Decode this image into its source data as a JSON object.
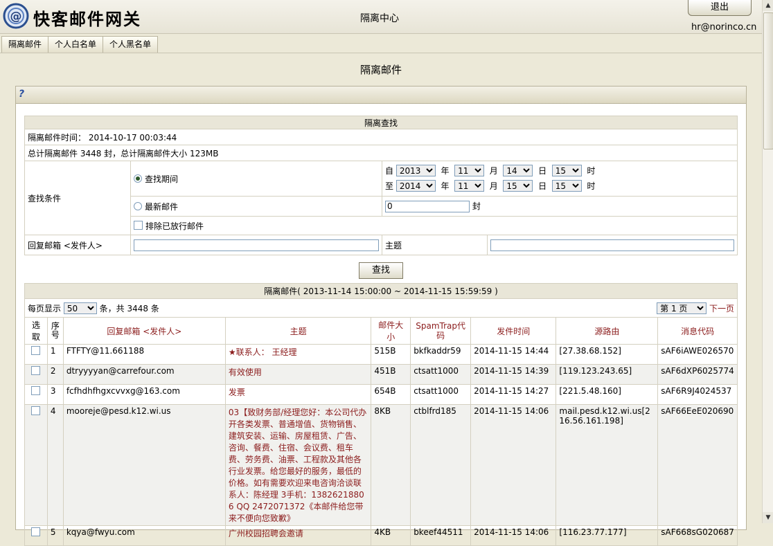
{
  "header": {
    "brand": "快客邮件网关",
    "center_title": "隔离中心",
    "logout_label": "退出",
    "user": "hr@norinco.cn"
  },
  "tabs": [
    "隔离邮件",
    "个人白名单",
    "个人黑名单"
  ],
  "main_title": "隔离邮件",
  "help_label": "?",
  "search": {
    "section_title": "隔离查找",
    "quarantine_time_label": "隔离邮件时间：",
    "quarantine_time_value": "2014-10-17 00:03:44",
    "summary": "总计隔离邮件 3448 封，总计隔离邮件大小 123MB",
    "criteria_label": "查找条件",
    "period_label": "查找期间",
    "from_label": "自",
    "to_label": "至",
    "year_unit": "年",
    "month_unit": "月",
    "day_unit": "日",
    "hour_unit": "时",
    "from": {
      "year": "2013",
      "month": "11",
      "day": "14",
      "hour": "15"
    },
    "to": {
      "year": "2014",
      "month": "11",
      "day": "15",
      "hour": "15"
    },
    "latest_label": "最新邮件",
    "latest_value": "0",
    "latest_unit": "封",
    "exclude_label": "排除已放行邮件",
    "sender_label": "回复邮箱 <发件人>",
    "sender_value": "",
    "subject_label": "主题",
    "subject_value": "",
    "find_button": "查找"
  },
  "results": {
    "title": "隔离邮件( 2013-11-14 15:00:00 ~ 2014-11-15 15:59:59 )",
    "per_page_label": "每页显示",
    "per_page_value": "50",
    "count_text": "条，共 3448 条",
    "page_value": "第 1 页",
    "next_label": "下一页",
    "columns": {
      "select": "选取",
      "seq": "序号",
      "sender": "回复邮箱 <发件人>",
      "subject": "主题",
      "size": "邮件大小",
      "spamtrap": "SpamTrap代码",
      "time": "发件时间",
      "route": "源路由",
      "msgid": "消息代码"
    },
    "rows": [
      {
        "seq": "1",
        "sender": "FTFTY@11.661188",
        "subject": "★联系人： 王经理",
        "size": "515B",
        "spamtrap": "bkfkaddr59",
        "time": "2014-11-15 14:44",
        "route": "[27.38.68.152]",
        "msgid": "sAF6iAWE026570"
      },
      {
        "seq": "2",
        "sender": "dtryyyyan@carrefour.com",
        "subject": "有效使用",
        "size": "451B",
        "spamtrap": "ctsatt1000",
        "time": "2014-11-15 14:39",
        "route": "[119.123.243.65]",
        "msgid": "sAF6dXP6025774"
      },
      {
        "seq": "3",
        "sender": "fcfhdhfhgxcvvxg@163.com",
        "subject": "发票",
        "size": "654B",
        "spamtrap": "ctsatt1000",
        "time": "2014-11-15 14:27",
        "route": "[221.5.48.160]",
        "msgid": "sAF6R9J4024537"
      },
      {
        "seq": "4",
        "sender": "mooreje@pesd.k12.wi.us",
        "subject": "03【致财务部/经理您好：本公司代办开各类发票、普通增值、货物销售、建筑安装、运输、房屋租赁、广告、咨询、餐费、住宿、会议费、租车费、劳务费、油票、工程款及其他各行业发票。给您最好的服务，最低的价格。如有需要欢迎来电咨询洽谈联系人：陈经理 3手机：13826218806 QQ 2472071372《本邮件给您带来不便向您致歉》",
        "size": "8KB",
        "spamtrap": "ctblfrd185",
        "time": "2014-11-15 14:06",
        "route": "mail.pesd.k12.wi.us[216.56.161.198]",
        "msgid": "sAF66EeE020690"
      },
      {
        "seq": "5",
        "sender": "kqya@fwyu.com",
        "subject": "广州校园招聘会邀请",
        "size": "4KB",
        "spamtrap": "bkeef44511",
        "time": "2014-11-15 14:06",
        "route": "[116.23.77.177]",
        "msgid": "sAF668sG020687"
      }
    ]
  }
}
